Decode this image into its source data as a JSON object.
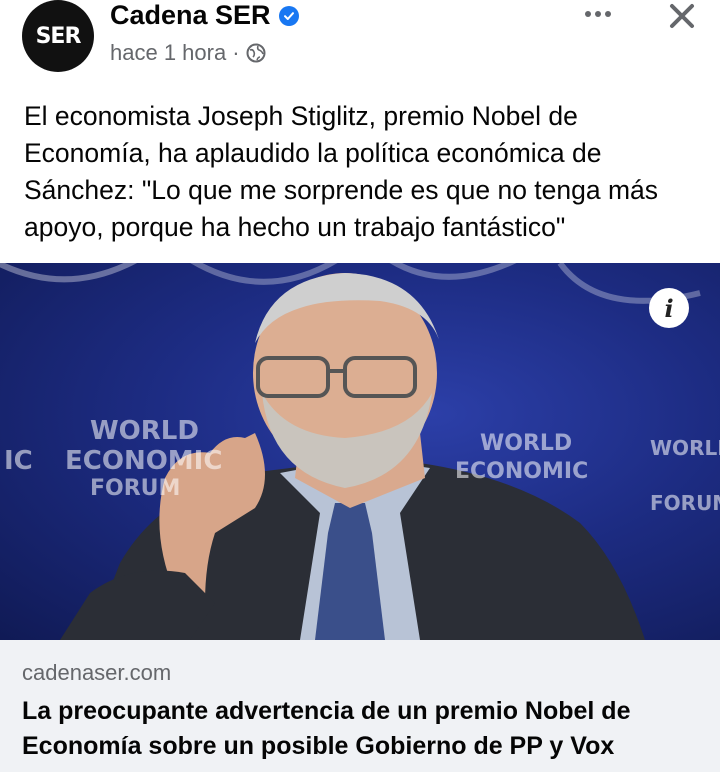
{
  "post": {
    "avatar_text": "SER",
    "page_name": "Cadena SER",
    "time": "hace 1 hora",
    "separator": "·",
    "icons": {
      "verified": "verified-badge-icon",
      "audience": "globe-icon",
      "more": "more-options-icon",
      "close": "close-icon"
    },
    "text": "El economista Joseph Stiglitz, premio Nobel de Economía, ha aplaudido la política económica de Sánchez: \"Lo que me sorprende es que no tenga más apoyo, porque ha hecho un trabajo fantástico\""
  },
  "photo": {
    "backdrop_text": [
      "WORLD",
      "ECONOMIC",
      "FORUM"
    ],
    "fragment_left": "IC",
    "info_label": "i"
  },
  "link": {
    "domain": "cadenaser.com",
    "title": "La preocupante advertencia de un premio Nobel de Economía sobre un posible Gobierno de PP y Vox"
  },
  "colors": {
    "brand_blue": "#1877f2",
    "secondary_text": "#65676b",
    "link_bar_bg": "#f0f2f5",
    "backdrop_blue": "#1d2c83"
  }
}
